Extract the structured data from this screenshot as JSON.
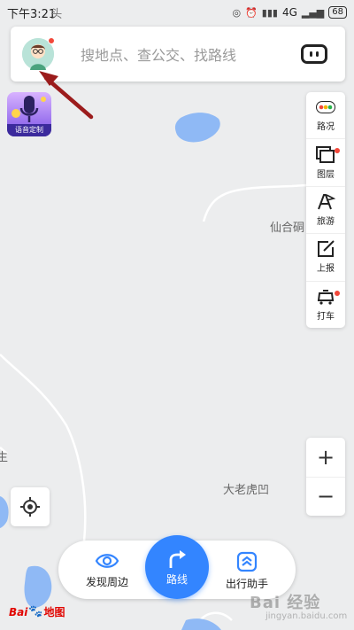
{
  "status_bar": {
    "time": "下午3:21",
    "map_label_fragment": "头",
    "network": "4G",
    "battery": "68"
  },
  "search": {
    "placeholder": "搜地点、查公交、找路线"
  },
  "voice_badge": {
    "label": "语音定制"
  },
  "toolbar": {
    "items": [
      {
        "label": "路况",
        "icon": "traffic-icon"
      },
      {
        "label": "图层",
        "icon": "layers-icon"
      },
      {
        "label": "旅游",
        "icon": "travel-icon"
      },
      {
        "label": "上报",
        "icon": "report-icon"
      },
      {
        "label": "打车",
        "icon": "taxi-icon"
      }
    ]
  },
  "map_labels": {
    "place_1": "仙合硐",
    "place_2": "大老虎凹",
    "place_3": "生"
  },
  "zoom": {
    "in": "+",
    "out": "−"
  },
  "bottom_nav": {
    "discover": "发现周边",
    "route": "路线",
    "assistant": "出行助手"
  },
  "logo": {
    "bai": "Bai",
    "du": "du",
    "ditu": "地图"
  },
  "watermark": {
    "text": "Bai 经验",
    "url": "jingyan.baidu.com"
  },
  "colors": {
    "accent": "#3385ff",
    "map_bg": "#eceded",
    "water": "#8fb9f5",
    "road": "#ffffff",
    "annotation_arrow": "#9b1c1c",
    "badge_dot": "#f2483a"
  }
}
